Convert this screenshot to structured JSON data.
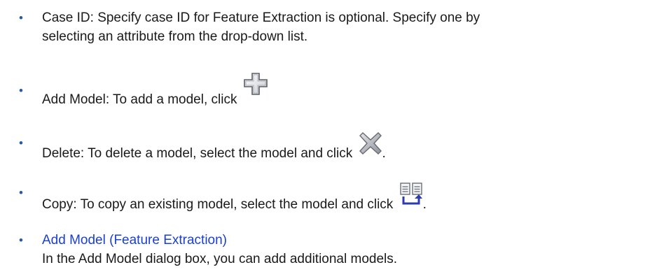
{
  "items": [
    {
      "bullet": "•",
      "line1": "Case ID: Specify case ID for Feature Extraction is optional. Specify one by",
      "line2": "selecting an attribute from the drop-down list."
    },
    {
      "bullet": "•",
      "text": "Add Model: To add a model, click",
      "icon": "add-icon"
    },
    {
      "bullet": "•",
      "text": "Delete: To delete a model, select the model and click",
      "icon": "delete-icon",
      "after": "."
    },
    {
      "bullet": "•",
      "text": "Copy: To copy an existing model, select the model and click",
      "icon": "copy-icon",
      "after": "."
    },
    {
      "bullet": "•",
      "link": "Add Model (Feature Extraction)",
      "line2": "In the Add Model dialog box, you can add additional models."
    }
  ],
  "colors": {
    "bullet": "#2c5aa0",
    "link": "#1a3fd4",
    "text": "#1a1a1a"
  }
}
